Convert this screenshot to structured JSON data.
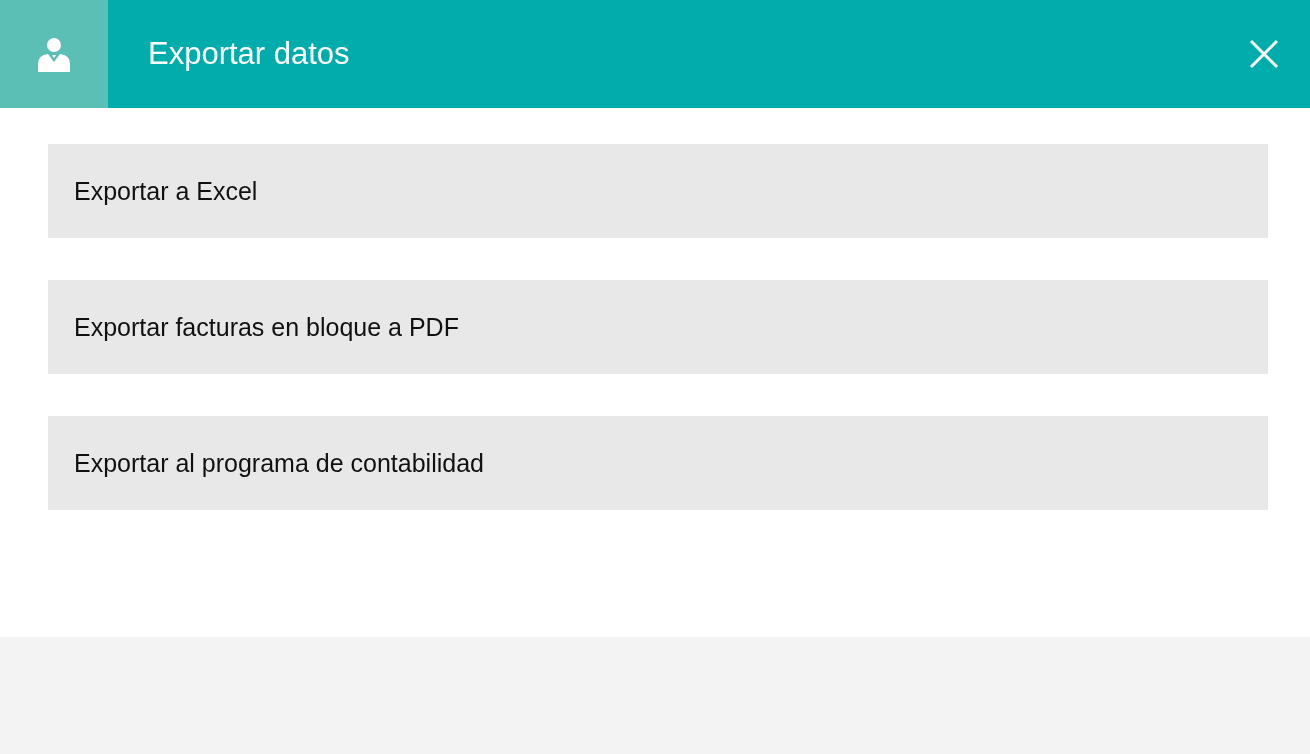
{
  "header": {
    "title": "Exportar datos"
  },
  "options": [
    {
      "label": "Exportar a Excel"
    },
    {
      "label": "Exportar facturas en bloque a PDF"
    },
    {
      "label": "Exportar al programa de contabilidad"
    }
  ]
}
